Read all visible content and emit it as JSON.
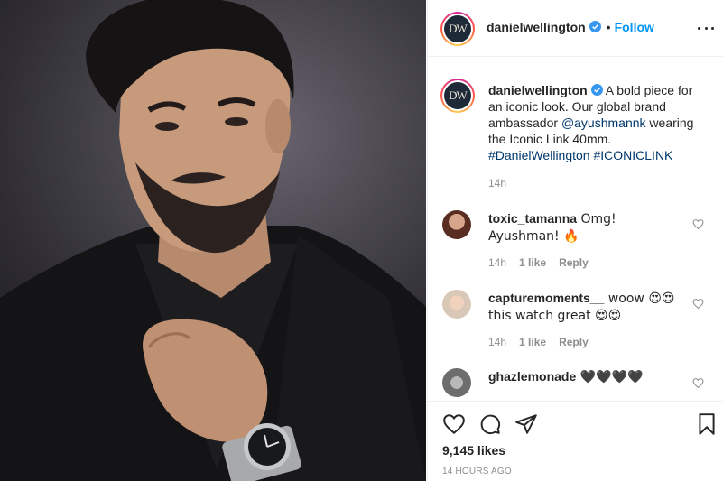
{
  "post": {
    "account": "danielwellington",
    "logo_text": "DW",
    "dot": "•",
    "follow_label": "Follow"
  },
  "caption": {
    "username": "danielwellington",
    "text_before": " A bold piece for an iconic look. Our global brand ambassador ",
    "mention": "@ayushmannk",
    "text_after": " wearing the Iconic Link 40mm. ",
    "hashtag1": "#DanielWellington",
    "hashtag2": "#ICONICLINK",
    "time": "14h"
  },
  "comments": [
    {
      "username": "toxic_tamanna",
      "text": " Omg! Ayushman! 🔥",
      "time": "14h",
      "likes": "1 like",
      "reply": "Reply"
    },
    {
      "username": "capturemoments__",
      "text": " woow 😍😍 this watch great 😍😍",
      "time": "14h",
      "likes": "1 like",
      "reply": "Reply"
    },
    {
      "username": "ghazlemonade",
      "text": " 🖤🖤🖤🖤"
    }
  ],
  "footer": {
    "likes": "9,145 likes",
    "time_ago": "14 HOURS AGO"
  },
  "colors": {
    "follow": "#0095f6",
    "link": "#00376b",
    "muted": "#8e8e8e",
    "verified": "#3897f0"
  },
  "icons": [
    "more-icon",
    "verified-icon",
    "heart-icon",
    "comment-icon",
    "share-icon",
    "bookmark-icon"
  ]
}
